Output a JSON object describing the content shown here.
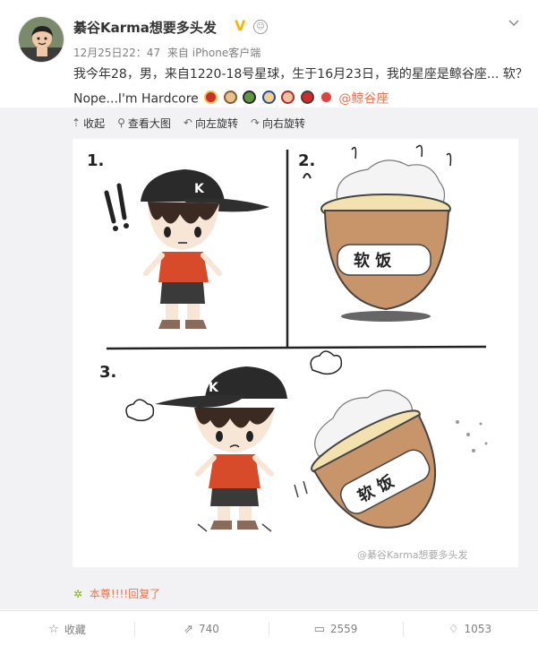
{
  "post": {
    "username": "綦谷Karma想要多头发",
    "verified_icon": "v-badge-icon",
    "level_icon": "robot-icon",
    "close_icon": "chevron-down-icon",
    "timestamp": "12月25日22：47",
    "source": "来自 iPhone客户端",
    "text_line1": "我今年28，男，来自1220-18号星球，生于16月23日，我的星座是鲸谷座... 软？",
    "text_line2": "Nope...I'm Hardcore",
    "emojis": [
      "iron-man",
      "thor",
      "hulk",
      "captain-america",
      "black-widow",
      "spiderman",
      "mushroom"
    ],
    "topic": "@鲸谷座"
  },
  "image_toolbar": {
    "collapse": "收起",
    "view_large": "查看大图",
    "rotate_left": "向左旋转",
    "rotate_right": "向右旋转"
  },
  "comic": {
    "panel1_label": "1.",
    "panel2_label": "2.",
    "panel3_label": "3.",
    "rice_label": "软 饭",
    "cap_letter": "K",
    "watermark": "@綦谷Karma想要多头发"
  },
  "reply": {
    "text": "本尊!!!!回复了"
  },
  "actions": {
    "favorite": "收藏",
    "repost": "740",
    "comment": "2559",
    "like": "1053"
  },
  "colors": {
    "link": "#eb7350",
    "verified": "#f7b500",
    "background": "#f2f2f5"
  }
}
